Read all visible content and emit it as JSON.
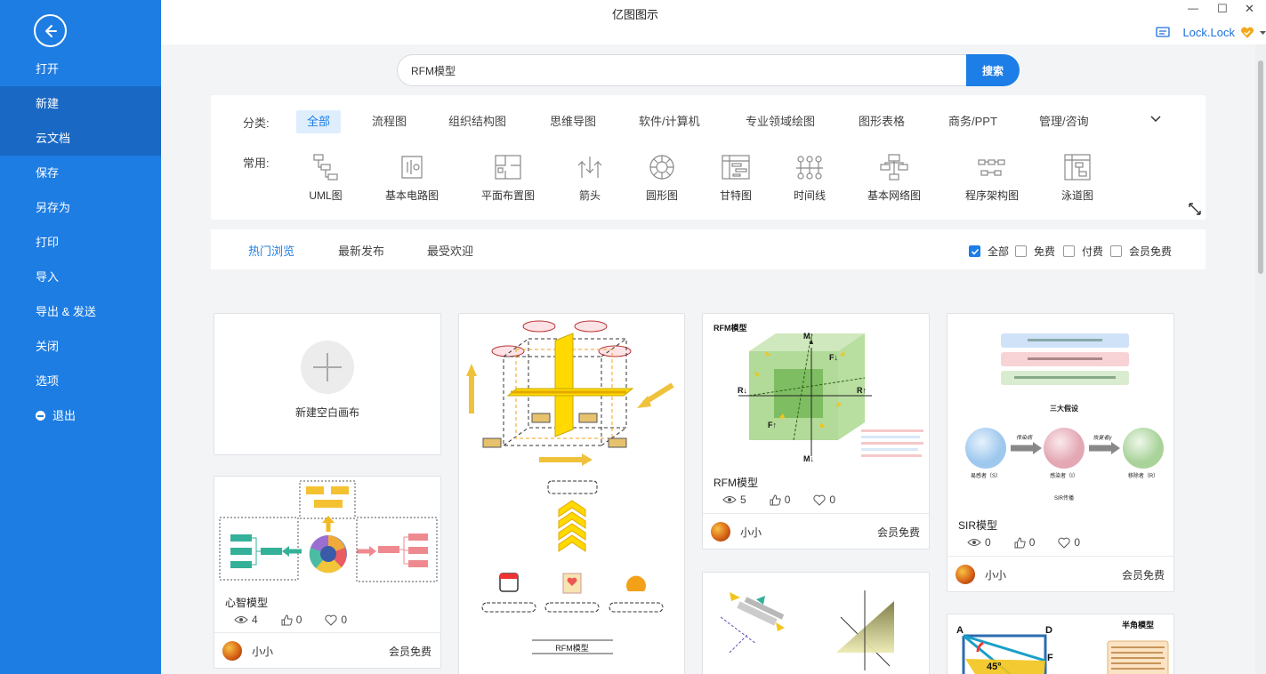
{
  "app": {
    "title": "亿图图示"
  },
  "window": {
    "minimize": "—",
    "maximize": "☐",
    "close": "✕"
  },
  "user": {
    "name": "Lock.Lock"
  },
  "sidebar": {
    "items": [
      {
        "label": "打开"
      },
      {
        "label": "新建",
        "active": true
      },
      {
        "label": "云文档"
      },
      {
        "label": "保存"
      },
      {
        "label": "另存为"
      },
      {
        "label": "打印"
      },
      {
        "label": "导入"
      },
      {
        "label": "导出 & 发送"
      },
      {
        "label": "关闭"
      },
      {
        "label": "选项"
      },
      {
        "label": "退出"
      }
    ]
  },
  "search": {
    "value": "RFM模型",
    "button": "搜索"
  },
  "categories": {
    "label": "分类:",
    "tabs": [
      "全部",
      "流程图",
      "组织结构图",
      "思维导图",
      "软件/计算机",
      "专业领域绘图",
      "图形表格",
      "商务/PPT",
      "管理/咨询"
    ],
    "common_label": "常用:",
    "common": [
      "UML图",
      "基本电路图",
      "平面布置图",
      "箭头",
      "圆形图",
      "甘特图",
      "时间线",
      "基本网络图",
      "程序架构图",
      "泳道图"
    ]
  },
  "browse_tabs": [
    "热门浏览",
    "最新发布",
    "最受欢迎"
  ],
  "filters": [
    "全部",
    "免费",
    "付费",
    "会员免费"
  ],
  "blank_card": {
    "label": "新建空白画布"
  },
  "cards": [
    {
      "title": "心智模型",
      "views": "4",
      "likes": "0",
      "favs": "0",
      "author": "小小",
      "price": "会员免费"
    },
    {
      "title": "RFM模型",
      "views": "5",
      "likes": "0",
      "favs": "0",
      "author": "小小",
      "price": "会员免费"
    },
    {
      "title": "SIR模型",
      "views": "0",
      "likes": "0",
      "favs": "0",
      "author": "小小",
      "price": "会员免费"
    }
  ],
  "thumb_text": {
    "rfm_header": "RFM模型",
    "rfm_m_up": "M↑",
    "rfm_m_down": "M↓",
    "rfm_r_left": "R↓",
    "rfm_r_right": "R↑",
    "rfm_f_up": "F↓",
    "rfm_f_down": "F↑",
    "rfm_caption": "RFM模型",
    "sir_title": "三大假设",
    "sir_s": "易感者（S）",
    "sir_i": "感染者（I）",
    "sir_r": "移除者（R）",
    "sir_arrow1": "传染病",
    "sir_arrow2": "恢复者γ",
    "sir_caption": "SIR传播",
    "half_title": "半角模型",
    "half_a": "A",
    "half_d": "D",
    "half_f": "F",
    "half_angle": "45°"
  },
  "colors": {
    "sidebar": "#1e7de3",
    "sidebar_active": "#1968c4",
    "accent": "#1c7ee6"
  }
}
